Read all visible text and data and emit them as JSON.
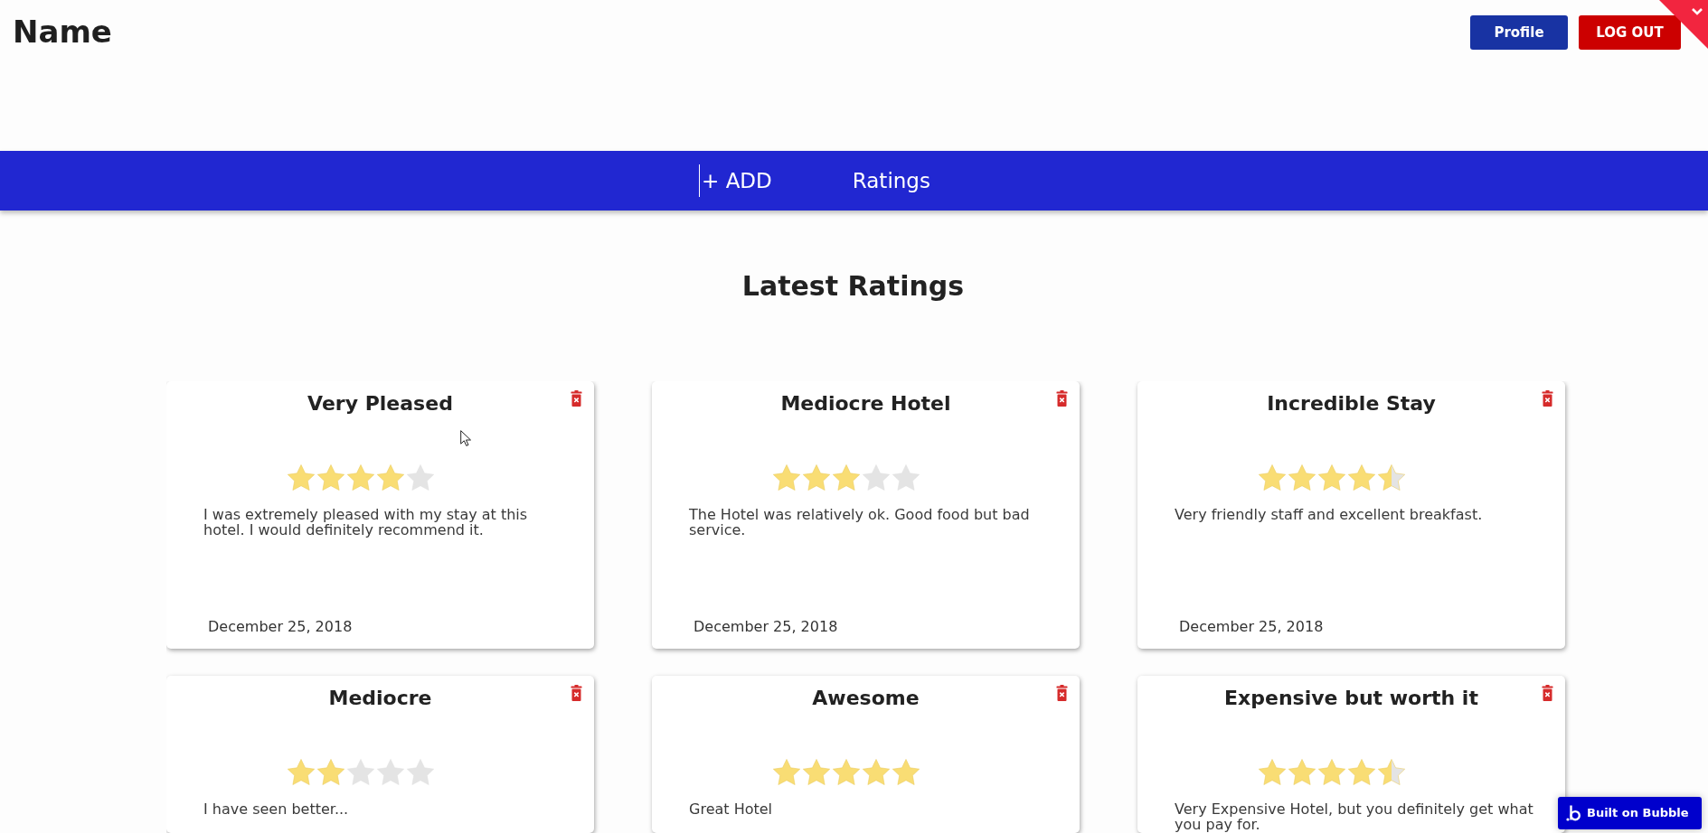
{
  "header": {
    "site_title": "Name",
    "buttons": [
      {
        "label": "Profile",
        "kind": "profile"
      },
      {
        "label": "LOG OUT",
        "kind": "logout"
      }
    ]
  },
  "nav": {
    "items": [
      {
        "label": "+ ADD"
      },
      {
        "label": "Ratings"
      }
    ]
  },
  "section": {
    "title": "Latest Ratings"
  },
  "ratings": [
    {
      "title": "Very Pleased",
      "stars": 4,
      "text": "I was extremely pleased with my stay at this hotel. I would definitely recommend it.",
      "date": "December 25, 2018"
    },
    {
      "title": "Mediocre Hotel",
      "stars": 3,
      "text": "The Hotel was relatively ok. Good food but bad service.",
      "date": "December 25, 2018"
    },
    {
      "title": "Incredible Stay",
      "stars": 4.5,
      "text": "Very friendly staff and excellent breakfast.",
      "date": "December 25, 2018"
    },
    {
      "title": "Mediocre",
      "stars": 2,
      "text": "I have seen better..."
    },
    {
      "title": "Awesome",
      "stars": 5,
      "text": "Great Hotel"
    },
    {
      "title": "Expensive but worth it",
      "stars": 4.5,
      "text": "Very Expensive Hotel, but you definitely get what you pay for."
    }
  ],
  "footer_badge": {
    "label": "Built on Bubble"
  }
}
